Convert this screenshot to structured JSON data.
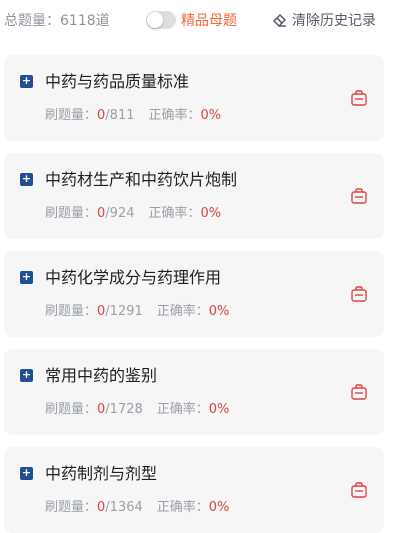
{
  "header": {
    "total_label": "总题量：",
    "total_count": "6118道",
    "toggle_label": "精品母题",
    "clear_label": "清除历史记录"
  },
  "colors": {
    "accent_orange": "#f0683e",
    "plus_blue": "#1f4f95",
    "stat_red": "#e0453e",
    "card_bg": "#f6f6f7"
  },
  "cards": [
    {
      "title": "中药与药品质量标准",
      "done_label": "刷题量：",
      "done": "0",
      "total": "/811",
      "rate_label": "正确率：",
      "rate": "0%"
    },
    {
      "title": "中药材生产和中药饮片炮制",
      "done_label": "刷题量：",
      "done": "0",
      "total": "/924",
      "rate_label": "正确率：",
      "rate": "0%"
    },
    {
      "title": "中药化学成分与药理作用",
      "done_label": "刷题量：",
      "done": "0",
      "total": "/1291",
      "rate_label": "正确率：",
      "rate": "0%"
    },
    {
      "title": "常用中药的鉴别",
      "done_label": "刷题量：",
      "done": "0",
      "total": "/1728",
      "rate_label": "正确率：",
      "rate": "0%"
    },
    {
      "title": "中药制剂与剂型",
      "done_label": "刷题量：",
      "done": "0",
      "total": "/1364",
      "rate_label": "正确率：",
      "rate": "0%"
    }
  ],
  "icons": {
    "expand": "plus-square-icon",
    "practice": "bag-icon",
    "clear": "eraser-icon"
  }
}
